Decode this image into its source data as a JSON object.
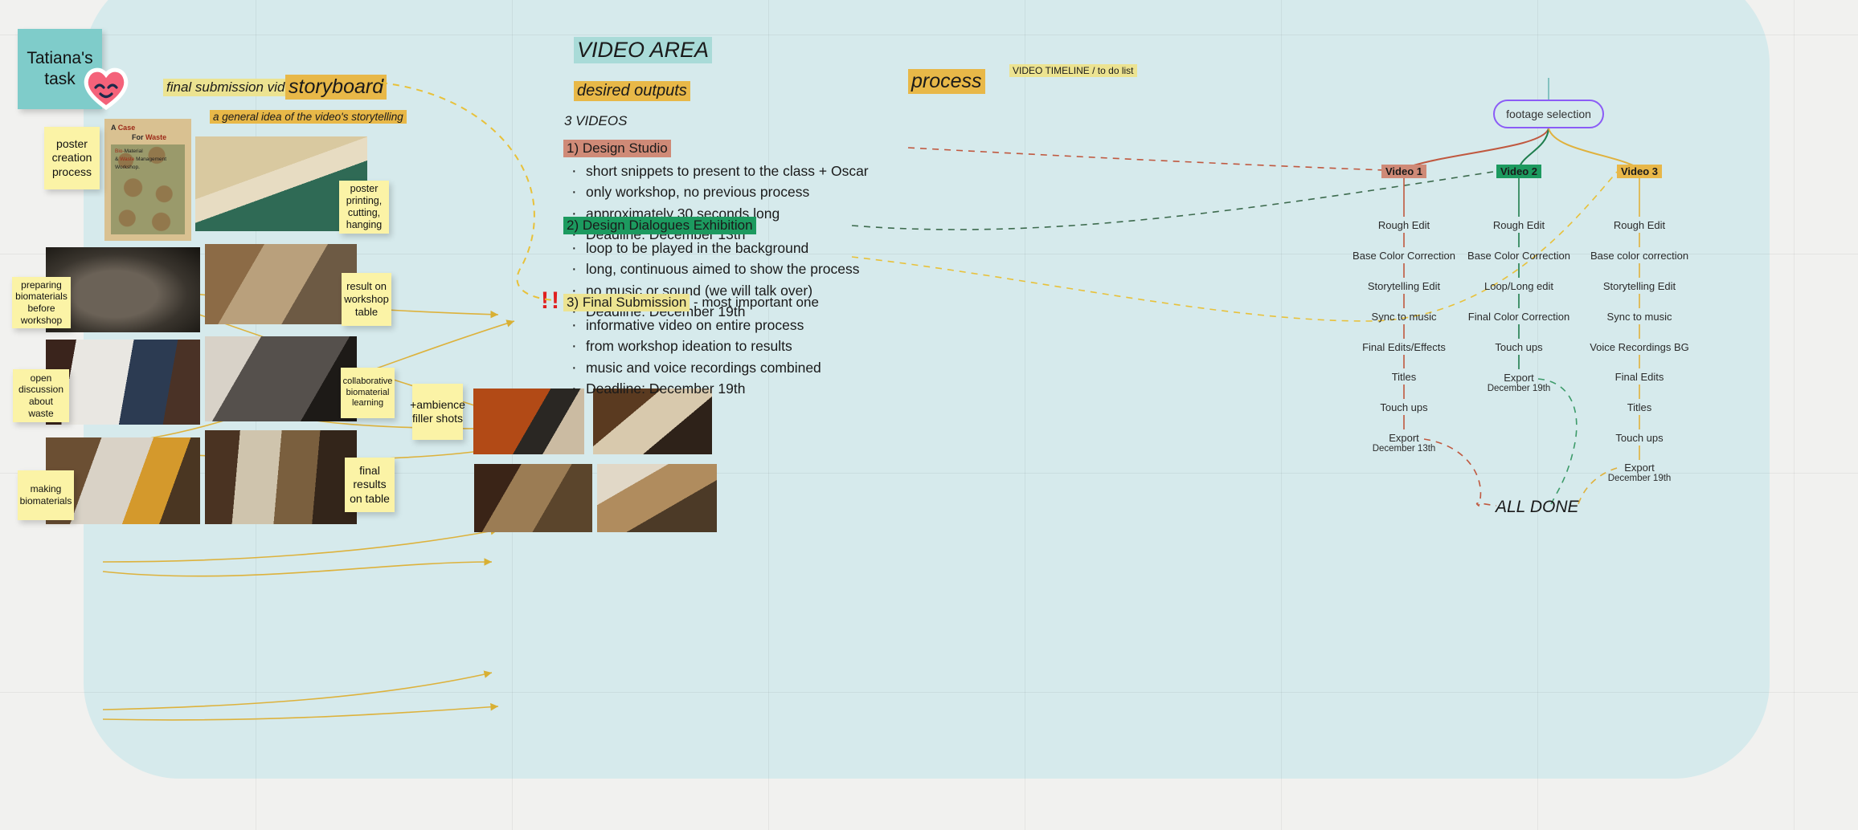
{
  "board": {
    "background_color": "#d6eaec",
    "canvas_color": "#f1f1ef"
  },
  "notes": {
    "task": "Tatiana's task",
    "poster_creation": "poster\ncreation\nprocess",
    "poster_printing": "poster\nprinting,\ncutting,\nhanging",
    "preparing": "preparing\nbiomaterials\nbefore\nworkshop",
    "result_table": "result on\nworkshop\ntable",
    "open_discussion": "open\ndiscussion\nabout\nwaste",
    "collaborative": "collaborative\nbiomaterial\nlearning",
    "making": "making\nbiomaterials",
    "final_results": "final\nresults\non table",
    "ambience": "+ambience\nfiller shots"
  },
  "labels": {
    "final_submission_video": "final submission video",
    "storyboard": "storyboard",
    "general_idea": "a general idea of the video's storytelling",
    "video_area": "VIDEO AREA",
    "desired_outputs": "desired outputs",
    "three_videos": "3 VIDEOS",
    "process": "process",
    "video_timeline": "VIDEO TIMELINE / to do list",
    "all_done": "ALL DONE",
    "bangs": "!!"
  },
  "poster": {
    "title_a": "A",
    "title_case": "Case",
    "title_for": "For",
    "title_waste": "Waste",
    "sub_line1_a": "Bio-",
    "sub_line1_b": "Material",
    "sub_line2_a": "&",
    "sub_line2_b": "Waste",
    "sub_line2_c": "Management",
    "sub_line3": "Workshop."
  },
  "outputs": [
    {
      "id": "design-studio",
      "title": "1) Design Studio",
      "highlight": "#cf8a77",
      "bullets": [
        "short snippets to present to the class + Oscar",
        "only workshop, no previous process",
        "approximately 30 seconds long",
        "Deadline: December 13th"
      ]
    },
    {
      "id": "design-dialogues",
      "title": "2) Design Dialogues Exhibition",
      "highlight": "#1c9a5f",
      "bullets": [
        "loop to be played in the background",
        "long, continuous aimed to show the process",
        "no music or sound (we will talk over)",
        "Deadline: December 19th"
      ]
    },
    {
      "id": "final-submission",
      "title": "3) Final Submission",
      "title_suffix": " - most important one",
      "highlight": "#ece391",
      "bullets": [
        "informative video on entire process",
        "from workshop ideation to results",
        "music and voice recordings combined",
        "Deadline: December 19th"
      ]
    }
  ],
  "timeline": {
    "root": "footage selection",
    "root_border_color": "#8b5cf6",
    "columns": [
      {
        "tag": "Video 1",
        "tag_color": "#cf8a77",
        "line_color": "#c0583f",
        "steps": [
          {
            "label": "Rough Edit"
          },
          {
            "label": "Base Color Correction"
          },
          {
            "label": "Storytelling Edit"
          },
          {
            "label": "Sync to music"
          },
          {
            "label": "Final Edits/Effects"
          },
          {
            "label": "Titles"
          },
          {
            "label": "Touch ups"
          },
          {
            "label": "Export",
            "sub": "December 13th"
          }
        ]
      },
      {
        "tag": "Video 2",
        "tag_color": "#1c9a5f",
        "line_color": "#1e7d4d",
        "steps": [
          {
            "label": "Rough Edit"
          },
          {
            "label": "Base Color Correction"
          },
          {
            "label": "Loop/Long edit"
          },
          {
            "label": "Final Color Correction"
          },
          {
            "label": "Touch ups"
          },
          {
            "label": "Export",
            "sub": "December 19th"
          }
        ]
      },
      {
        "tag": "Video 3",
        "tag_color": "#e8b748",
        "line_color": "#e0b13c",
        "steps": [
          {
            "label": "Rough Edit"
          },
          {
            "label": "Base color correction"
          },
          {
            "label": "Storytelling Edit"
          },
          {
            "label": "Sync to music"
          },
          {
            "label": "Voice Recordings BG"
          },
          {
            "label": "Final Edits"
          },
          {
            "label": "Titles"
          },
          {
            "label": "Touch ups"
          },
          {
            "label": "Export",
            "sub": "December 19th"
          }
        ]
      }
    ]
  }
}
